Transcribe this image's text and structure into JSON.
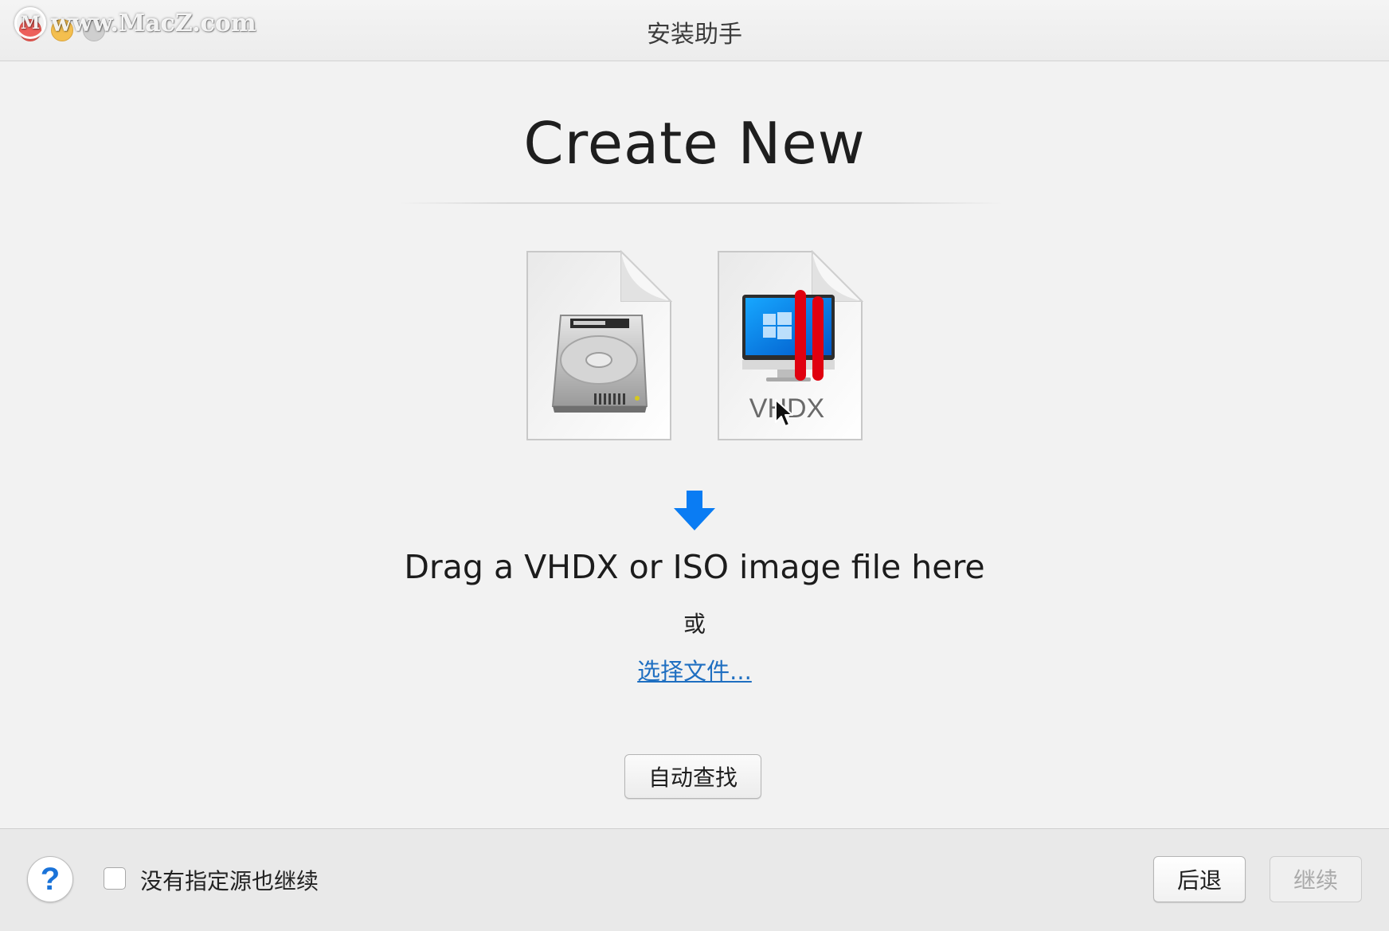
{
  "watermark": {
    "text": "www.MacZ.com",
    "logo_letter": "M"
  },
  "window": {
    "title": "安装助手"
  },
  "main": {
    "heading": "Create New",
    "vhdx_label": "VHDX",
    "drop_text": "Drag a VHDX or ISO image file here",
    "or_text": "或",
    "choose_file_label": "选择文件...",
    "auto_find_label": "自动查找"
  },
  "footer": {
    "help_label": "?",
    "checkbox_label": "没有指定源也继续",
    "checkbox_checked": false,
    "back_label": "后退",
    "continue_label": "继续",
    "continue_enabled": false
  },
  "icons": {
    "hdd_doc": "hard-disk-document-icon",
    "vhdx_doc": "vhdx-document-icon",
    "down_arrow": "down-arrow-icon"
  },
  "colors": {
    "accent_blue": "#1a73d9",
    "link_blue": "#1f6fc1",
    "parallels_red": "#e0000f",
    "close": "#ed5f5a",
    "minimize": "#f4bf4f"
  }
}
